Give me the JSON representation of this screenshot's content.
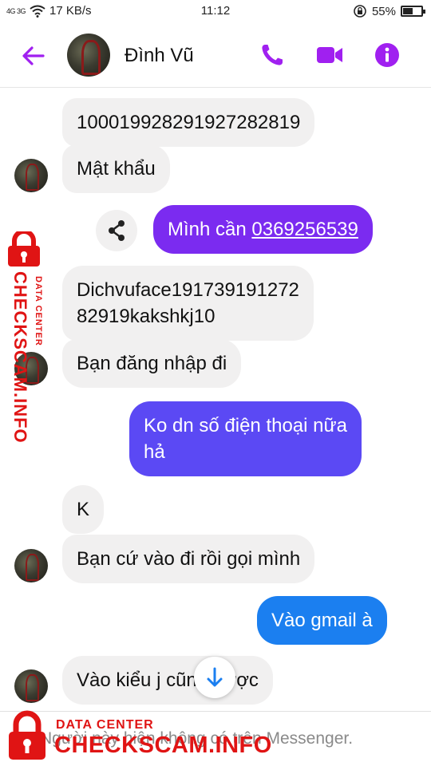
{
  "status_bar": {
    "signal": "4G 3G",
    "network_speed": "17 KB/s",
    "time": "11:12",
    "battery_percent": "55%",
    "battery_level": 0.55
  },
  "header": {
    "contact_name": "Đình Vũ",
    "accent_color": "#a020f0"
  },
  "messages": [
    {
      "from": "them",
      "text": "100019928291927282819"
    },
    {
      "from": "them",
      "text": "Mật khẩu"
    },
    {
      "from": "me",
      "text_prefix": "Mình cần ",
      "phone": "0369256539"
    },
    {
      "from": "them",
      "lines": [
        "Dichvuface191739191272",
        "82919kakshkj10"
      ]
    },
    {
      "from": "them",
      "text": "Bạn đăng nhập đi"
    },
    {
      "from": "me",
      "lines": [
        "Ko dn số điện thoại nữa",
        "hả"
      ]
    },
    {
      "from": "them",
      "text": "K"
    },
    {
      "from": "them",
      "text": "Bạn cứ vào đi rồi gọi mình"
    },
    {
      "from": "me",
      "text": "Vào gmail à"
    },
    {
      "from": "them",
      "text": "Vào kiểu j cũng được"
    }
  ],
  "footer": {
    "notice": "Người này hiện không có trên Messenger."
  },
  "watermark": {
    "small": "DATA CENTER",
    "big": "CHECKSCAM.INFO"
  },
  "colors": {
    "bubble_in": "#f1f0f0",
    "bubble_out_purple": "#7b2bf0",
    "bubble_out_indigo": "#5b49f4",
    "bubble_out_blue": "#1b7ff0",
    "watermark_red": "#e01414"
  }
}
